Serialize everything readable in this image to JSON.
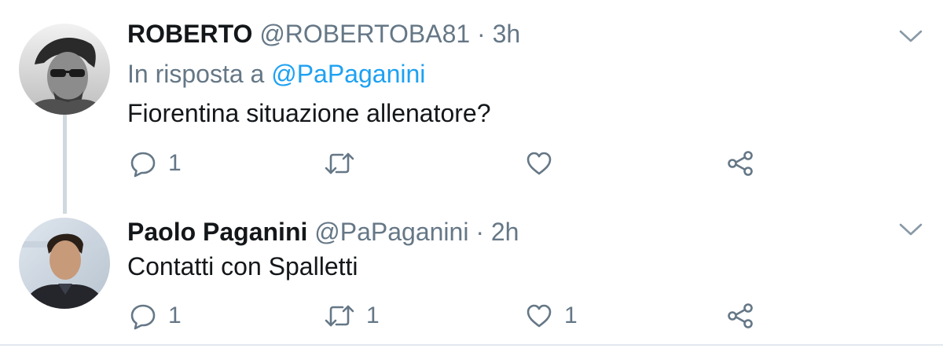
{
  "tweets": [
    {
      "display_name": "ROBERTO",
      "handle": "@ROBERTOBA81",
      "separator": "·",
      "time": "3h",
      "reply_prefix": "In risposta a",
      "reply_to": "@PaPaganini",
      "text": "Fiorentina situazione allenatore?",
      "replies": "1",
      "retweets": "",
      "likes": ""
    },
    {
      "display_name": "Paolo Paganini",
      "handle": "@PaPaganini",
      "separator": "·",
      "time": "2h",
      "text": "Contatti con Spalletti",
      "replies": "1",
      "retweets": "1",
      "likes": "1"
    }
  ],
  "icons": {
    "reply": "reply-bubble-icon",
    "retweet": "retweet-icon",
    "like": "heart-icon",
    "share": "share-icon",
    "more": "chevron-down-icon"
  },
  "colors": {
    "text": "#14171a",
    "secondary": "#657786",
    "link": "#1da1f2",
    "thread_line": "#cfd9de",
    "divider": "#e1e8ed"
  }
}
